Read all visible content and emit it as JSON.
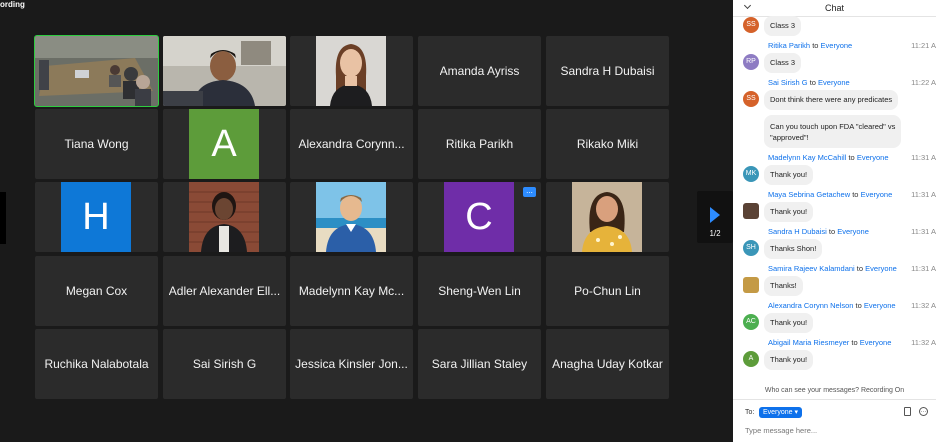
{
  "recording_label": "ording",
  "pager": {
    "page_label": "1/2"
  },
  "colors": {
    "accent": "#2d8cff",
    "active_speaker": "#2ecc40",
    "tile_bg": "#2b2b2b",
    "avatar_green": "#5d9c3a",
    "avatar_blue": "#0e78d7",
    "avatar_purple": "#6f2da8"
  },
  "tiles": [
    {
      "type": "video",
      "scene": "room",
      "active": true
    },
    {
      "type": "video",
      "scene": "man-laptop"
    },
    {
      "type": "video",
      "scene": "woman-portrait"
    },
    {
      "type": "name",
      "name": "Amanda Ayriss"
    },
    {
      "type": "name",
      "name": "Sandra H Dubaisi"
    },
    {
      "type": "name",
      "name": "Tiana Wong"
    },
    {
      "type": "avatar",
      "letter": "A",
      "color": "#5d9c3a"
    },
    {
      "type": "name",
      "name": "Alexandra Corynn..."
    },
    {
      "type": "name",
      "name": "Ritika Parikh"
    },
    {
      "type": "name",
      "name": "Rikako Miki"
    },
    {
      "type": "avatar",
      "letter": "H",
      "color": "#0e78d7"
    },
    {
      "type": "video",
      "scene": "woman-brick"
    },
    {
      "type": "video",
      "scene": "man-beach"
    },
    {
      "type": "avatar",
      "letter": "C",
      "color": "#6f2da8",
      "more_button": "..."
    },
    {
      "type": "video",
      "scene": "woman-yellow"
    },
    {
      "type": "name",
      "name": "Megan Cox"
    },
    {
      "type": "name",
      "name": "Adler Alexander Ell..."
    },
    {
      "type": "name",
      "name": "Madelynn Kay Mc..."
    },
    {
      "type": "name",
      "name": "Sheng-Wen Lin"
    },
    {
      "type": "name",
      "name": "Po-Chun Lin"
    },
    {
      "type": "name",
      "name": "Ruchika Nalabotala"
    },
    {
      "type": "name",
      "name": "Sai Sirish G"
    },
    {
      "type": "name",
      "name": "Jessica Kinsler Jon..."
    },
    {
      "type": "name",
      "name": "Sara Jillian Staley"
    },
    {
      "type": "name",
      "name": "Anagha Uday Kotkar"
    }
  ],
  "chat": {
    "title": "Chat",
    "messages": [
      {
        "avatar": "SS",
        "avatar_color": "#d5622a",
        "bubbles": [
          "Class 3"
        ]
      },
      {
        "sender": "Ritika Parikh",
        "to": "Everyone",
        "time": "11:21 A",
        "avatar": "RP",
        "avatar_color": "#8e7cc3",
        "bubbles": [
          "Class 3"
        ]
      },
      {
        "sender": "Sai Sirish G",
        "to": "Everyone",
        "time": "11:22 A",
        "avatar": "SS",
        "avatar_color": "#d5622a",
        "bubbles": [
          "Dont think there were any predicates"
        ]
      },
      {
        "bubbles": [
          [
            "Can you touch upon FDA \"cleared\" vs",
            "\"approved\"!"
          ]
        ]
      },
      {
        "sender": "Madelynn Kay McCahill",
        "to": "Everyone",
        "time": "11:31 A",
        "avatar": "MK",
        "avatar_color": "#3a96b8",
        "bubbles": [
          "Thank you!"
        ]
      },
      {
        "sender": "Maya Sebrina Getachew",
        "to": "Everyone",
        "time": "11:31 A",
        "avatar": "",
        "avatar_color": "#5a4235",
        "bubbles": [
          "Thank you!"
        ]
      },
      {
        "sender": "Sandra H Dubaisi",
        "to": "Everyone",
        "time": "11:31 A",
        "avatar": "SH",
        "avatar_color": "#3a96b8",
        "bubbles": [
          "Thanks Shon!"
        ]
      },
      {
        "sender": "Samira Rajeev Kalamdani",
        "to": "Everyone",
        "time": "11:31 A",
        "avatar": "",
        "avatar_color": "#c49a45",
        "bubbles": [
          "Thanks!"
        ]
      },
      {
        "sender": "Alexandra Corynn Nelson",
        "to": "Everyone",
        "time": "11:32 A",
        "avatar": "AC",
        "avatar_color": "#4caf50",
        "bubbles": [
          "Thank you!"
        ]
      },
      {
        "sender": "Abigail Maria Riesmeyer",
        "to": "Everyone",
        "time": "11:32 A",
        "avatar": "A",
        "avatar_color": "#5d9c3a",
        "bubbles": [
          "Thank you!"
        ]
      }
    ],
    "who_can_see": "Who can see your messages? Recording On",
    "to_label": "To:",
    "recipient": "Everyone",
    "input_placeholder": "Type message here..."
  }
}
